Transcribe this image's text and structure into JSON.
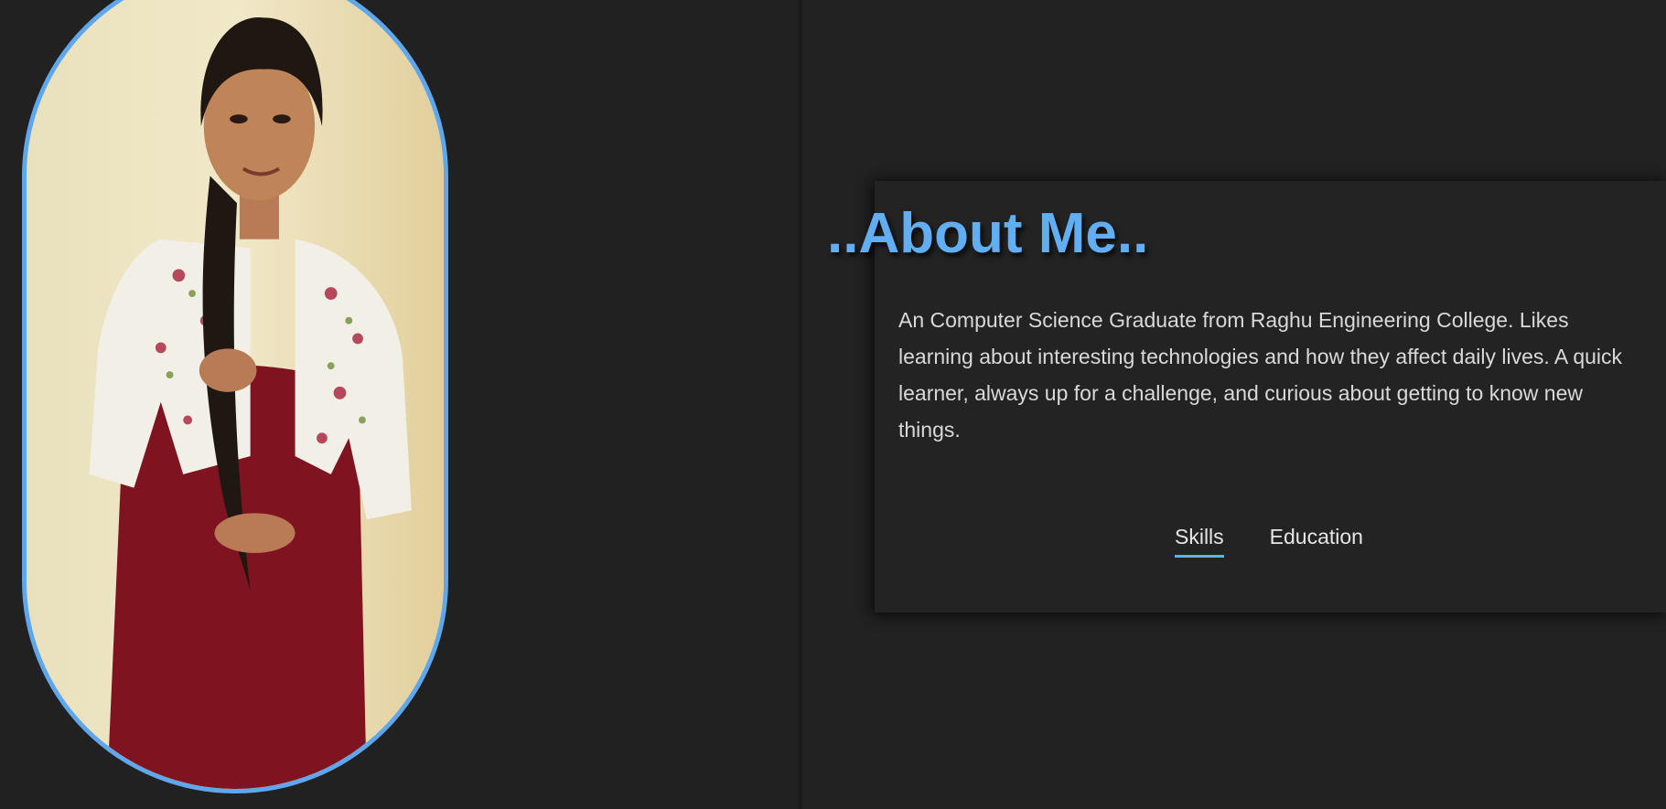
{
  "about": {
    "title": "..About Me..",
    "description": "An Computer Science Graduate from Raghu Engineering College. Likes learning about interesting technologies and how they affect daily lives. A quick learner, always up for a challenge, and curious about getting to know new things."
  },
  "tabs": [
    {
      "label": "Skills",
      "active": true
    },
    {
      "label": "Education",
      "active": false
    }
  ],
  "colors": {
    "accent": "#61aef2",
    "background": "#212121",
    "text": "#d9d9d9"
  }
}
